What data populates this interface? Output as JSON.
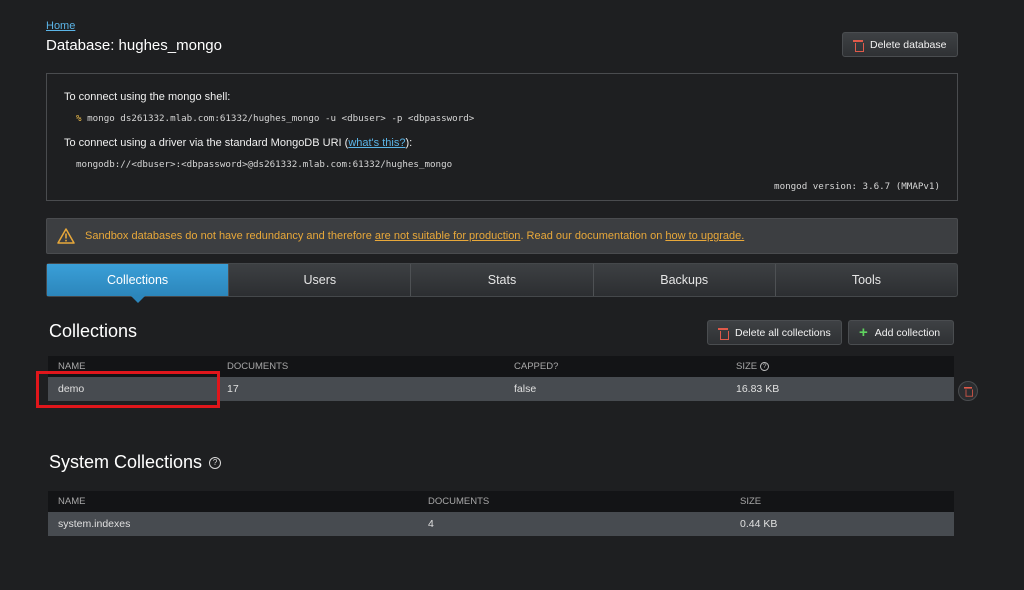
{
  "header": {
    "breadcrumb": "Home",
    "title": "Database: hughes_mongo",
    "delete_database": "Delete database"
  },
  "connection": {
    "shell_label": "To connect using the mongo shell:",
    "shell_prompt": "%",
    "shell_command": "mongo ds261332.mlab.com:61332/hughes_mongo -u <dbuser> -p <dbpassword>",
    "driver_label_pre": "To connect using a driver via the standard MongoDB URI (",
    "driver_link": "what's this?",
    "driver_label_post": "):",
    "uri": "mongodb://<dbuser>:<dbpassword>@ds261332.mlab.com:61332/hughes_mongo",
    "version": "mongod version: 3.6.7 (MMAPv1)"
  },
  "warning": {
    "text_1": "Sandbox databases do not have redundancy and therefore ",
    "link_1": "are not suitable for production",
    "text_2": ". Read our documentation on ",
    "link_2": "how to upgrade."
  },
  "tabs": [
    "Collections",
    "Users",
    "Stats",
    "Backups",
    "Tools"
  ],
  "collections": {
    "title": "Collections",
    "delete_all": "Delete all collections",
    "add": "Add collection",
    "columns": [
      "NAME",
      "DOCUMENTS",
      "CAPPED?",
      "SIZE"
    ],
    "rows": [
      {
        "name": "demo",
        "documents": "17",
        "capped": "false",
        "size": "16.83 KB"
      }
    ]
  },
  "system_collections": {
    "title": "System Collections",
    "columns": [
      "NAME",
      "DOCUMENTS",
      "SIZE"
    ],
    "rows": [
      {
        "name": "system.indexes",
        "documents": "4",
        "size": "0.44 KB"
      }
    ]
  },
  "colors": {
    "accent": "#2c86bb",
    "warning": "#e8a83a",
    "danger": "#e05a4a",
    "highlight": "#e0161b"
  }
}
